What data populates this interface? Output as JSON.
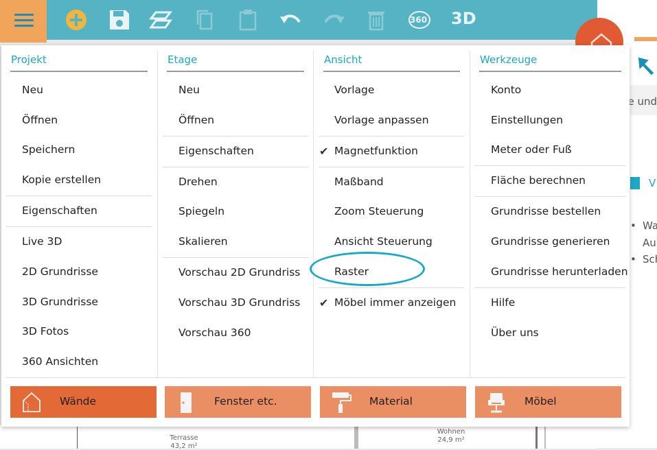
{
  "toolbar": {
    "view_360": "360",
    "view_3d": "3D"
  },
  "right_panel": {
    "text_1": "de und",
    "text_2": "V",
    "text_3": "Wa",
    "text_4": "Au",
    "text_5": "Sch"
  },
  "floor": {
    "room_1_name": "Terrasse",
    "room_1_area": "43,2 m²",
    "room_2_name": "Wohnen",
    "room_2_area": "24,9 m²"
  },
  "menu": {
    "projekt": {
      "title": "Projekt",
      "items": [
        "Neu",
        "Öffnen",
        "Speichern",
        "Kopie erstellen",
        "Eigenschaften",
        "Live 3D",
        "2D Grundrisse",
        "3D Grundrisse",
        "3D Fotos",
        "360 Ansichten"
      ]
    },
    "etage": {
      "title": "Etage",
      "items": [
        "Neu",
        "Öffnen",
        "Eigenschaften",
        "Drehen",
        "Spiegeln",
        "Skalieren",
        "Vorschau 2D Grundriss",
        "Vorschau 3D Grundriss",
        "Vorschau 360"
      ]
    },
    "ansicht": {
      "title": "Ansicht",
      "items": [
        "Vorlage",
        "Vorlage anpassen",
        "Magnetfunktion",
        "Maßband",
        "Zoom Steuerung",
        "Ansicht Steuerung",
        "Raster",
        "Möbel immer anzeigen"
      ]
    },
    "werkzeuge": {
      "title": "Werkzeuge",
      "items": [
        "Konto",
        "Einstellungen",
        "Meter oder Fuß",
        "Fläche berechnen",
        "Grundrisse bestellen",
        "Grundrisse generieren",
        "Grundrisse herunterladen",
        "Hilfe",
        "Über uns"
      ]
    }
  },
  "bottom_buttons": [
    "Wände",
    "Fenster etc.",
    "Material",
    "Möbel"
  ],
  "colors": {
    "accent": "#1fa7c4",
    "toolbar": "#55b3c4",
    "orange_active": "#e36a37",
    "orange": "#e98f63",
    "menu_button": "#f0a55a"
  },
  "icons": [
    "menu-icon",
    "add-icon",
    "save-icon",
    "layers-icon",
    "copy-icon",
    "paste-icon",
    "undo-icon",
    "redo-icon",
    "delete-icon",
    "view-360-icon",
    "view-3d-icon",
    "home-icon",
    "cursor-icon",
    "check-icon",
    "wall-icon",
    "door-icon",
    "paint-roller-icon",
    "chair-icon"
  ]
}
